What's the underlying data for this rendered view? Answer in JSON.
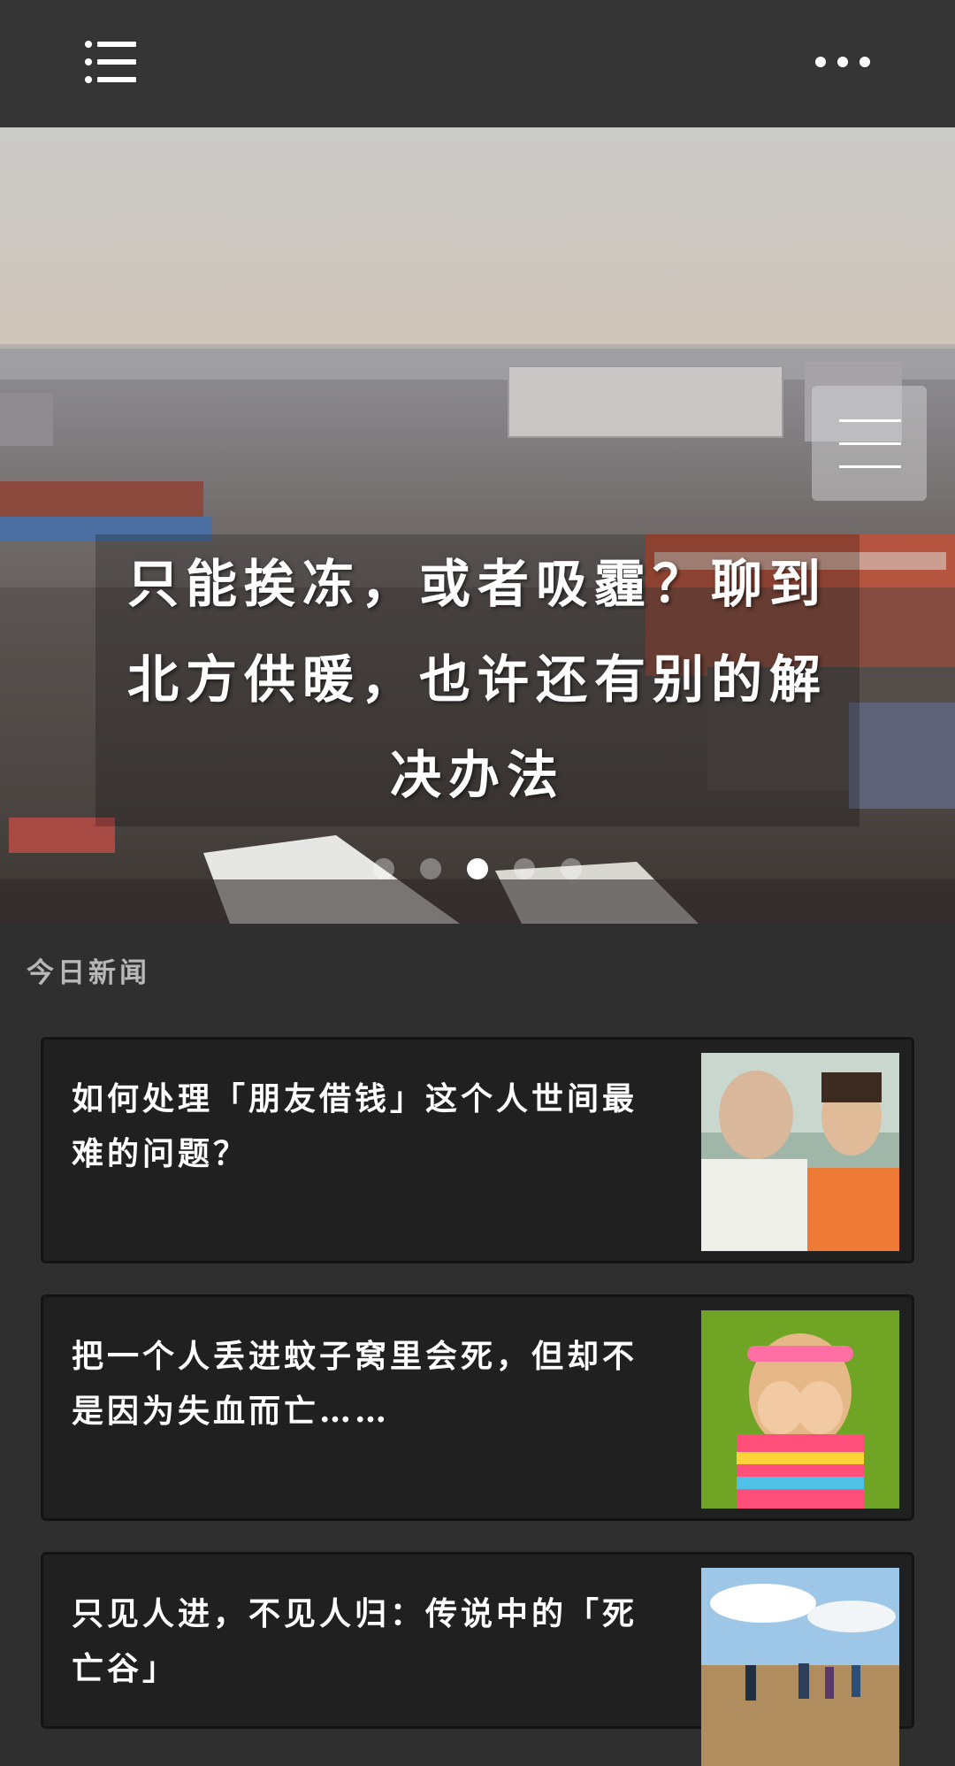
{
  "topbar": {
    "menu_icon": "list-icon",
    "more_icon": "more-horizontal-icon"
  },
  "hero": {
    "title": "只能挨冻，或者吸霾？聊到北方供暖，也许还有别的解决办法",
    "image_icon": "city-smog-photo",
    "menu_icon": "hamburger-icon",
    "slides": 5,
    "active_slide": 3
  },
  "section": {
    "title": "今日新闻"
  },
  "news": [
    {
      "title": "如何处理「朋友借钱」这个人世间最难的问题？",
      "thumb_icon": "couple-photo"
    },
    {
      "title": "把一个人丢进蚊子窝里会死，但却不是因为失血而亡……",
      "thumb_icon": "girl-covering-eyes-photo"
    },
    {
      "title": "只见人进，不见人归：传说中的「死亡谷」",
      "thumb_icon": "hikers-photo"
    }
  ]
}
